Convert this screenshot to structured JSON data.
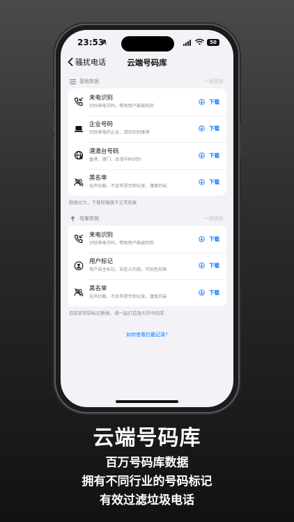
{
  "status_bar": {
    "time": "23:53",
    "battery": "50"
  },
  "nav": {
    "back_label": "骚扰电话",
    "title": "云端号码库"
  },
  "basic_section": {
    "title": "基础数据",
    "action": "一键更新",
    "items": [
      {
        "title": "来电识别",
        "subtitle": "识别来电号码，帮助用户躲避风险",
        "action": "下载",
        "icon": "phone-incoming-icon"
      },
      {
        "title": "企业号码",
        "subtitle": "识别来电的企业，成功识别推销",
        "action": "下载",
        "icon": "laptop-icon"
      },
      {
        "title": "港澳台号码",
        "subtitle": "香港、澳门、台湾号码识别",
        "action": "下载",
        "icon": "globe-icon"
      },
      {
        "title": "黑名单",
        "subtitle": "无声拦截，不会有提示和记录，谨慎开启",
        "action": "下载",
        "icon": "blocked-users-icon"
      }
    ],
    "note": "数据过大，下载较慢属于正常现象"
  },
  "incremental_section": {
    "title": "增量数据",
    "action": "一键更新",
    "items": [
      {
        "title": "来电识别",
        "subtitle": "识别来电号码，帮助用户躲避风险",
        "action": "下载",
        "icon": "phone-incoming-icon"
      },
      {
        "title": "用户标记",
        "subtitle": "用户自主标记，自定义内容，可玩性较高",
        "action": "下载",
        "icon": "user-tag-icon"
      },
      {
        "title": "黑名单",
        "subtitle": "无声拦截，不会有提示和记录，谨慎开启",
        "action": "下载",
        "icon": "blocked-users-icon"
      }
    ],
    "note": "目前非常缺标记数据，请一起打造强大的号码库"
  },
  "help_link": "如何查看拦截记录?",
  "promo": {
    "headline": "云端号码库",
    "lines": [
      "百万号码库数据",
      "拥有不同行业的号码标记",
      "有效过滤垃圾电话"
    ]
  },
  "colors": {
    "accent": "#0a7aff",
    "background": "#f2f2f7"
  }
}
